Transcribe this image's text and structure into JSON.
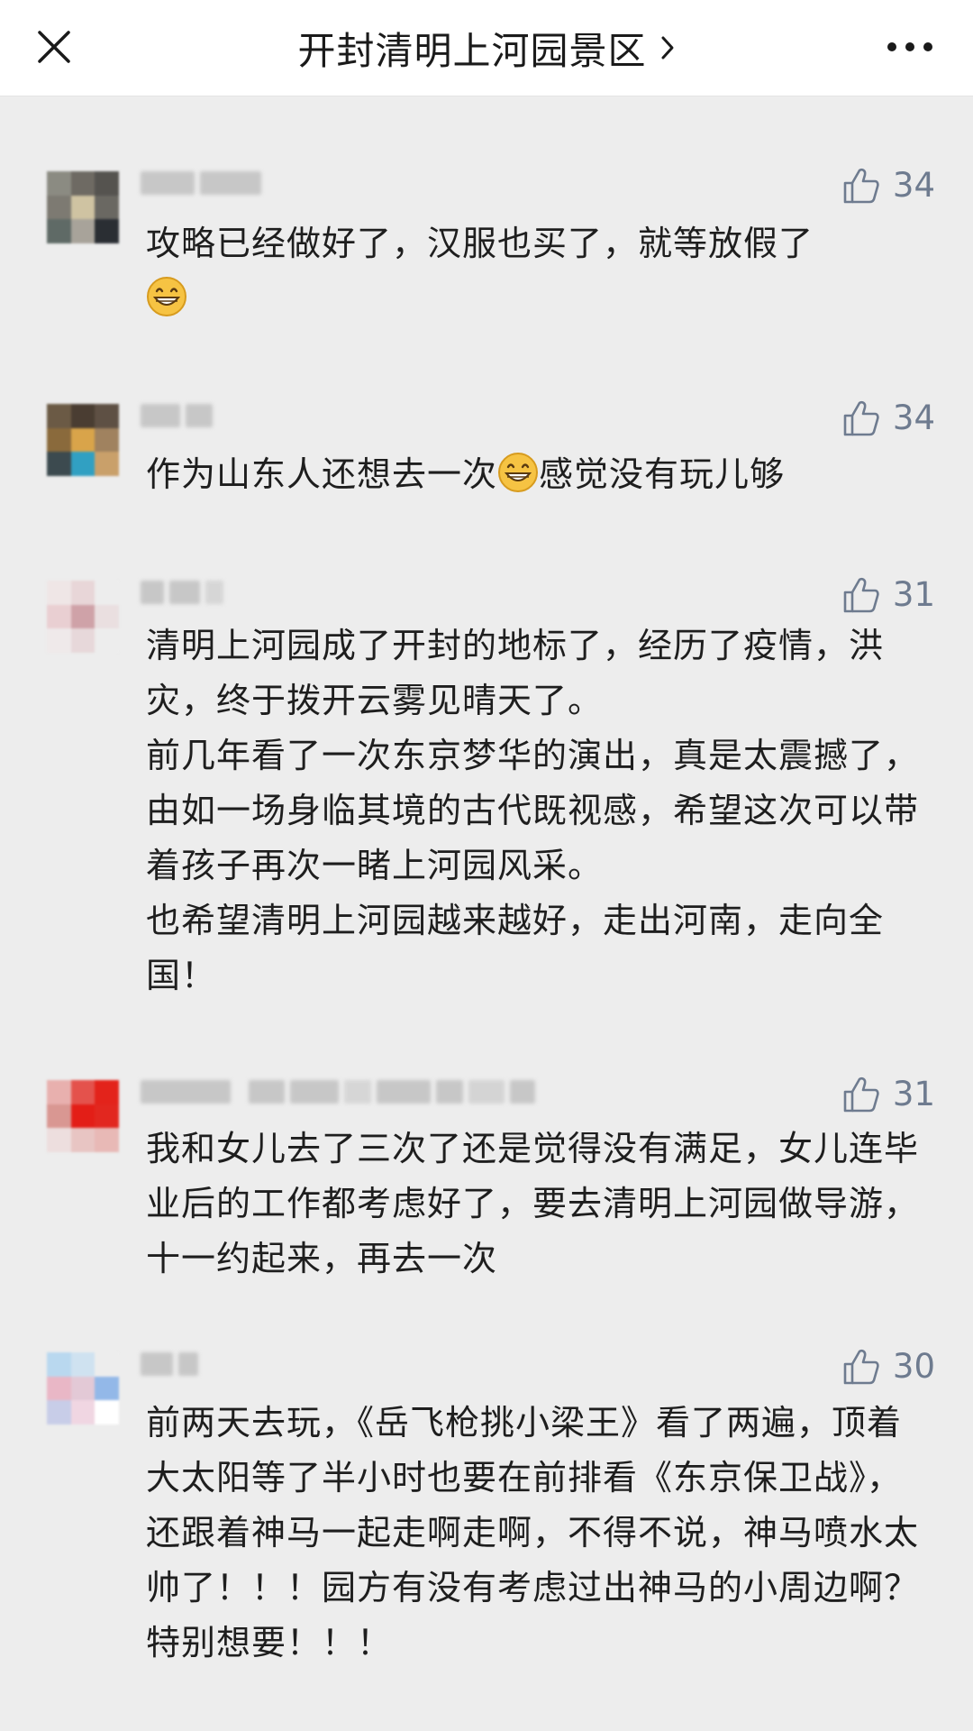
{
  "header": {
    "title": "开封清明上河园景区",
    "close_icon": "close-icon",
    "chevron_icon": "chevron-right-icon",
    "more_icon": "more-dots-icon"
  },
  "comments": [
    {
      "likes": "34",
      "text_before_emoji": "攻略已经做好了，汉服也买了，就等放假了",
      "emoji": "grinning-face-icon",
      "text_after_emoji": ""
    },
    {
      "likes": "34",
      "text_before_emoji": "作为山东人还想去一次",
      "emoji": "grinning-face-icon",
      "text_after_emoji": "感觉没有玩儿够"
    },
    {
      "likes": "31",
      "text": "清明上河园成了开封的地标了，经历了疫情，洪灾，终于拨开云雾见晴天了。\n前几年看了一次东京梦华的演出，真是太震撼了，由如一场身临其境的古代既视感，希望这次可以带着孩子再次一睹上河园风采。\n也希望清明上河园越来越好，走出河南，走向全国！"
    },
    {
      "likes": "31",
      "text": "我和女儿去了三次了还是觉得没有满足，女儿连毕业后的工作都考虑好了，要去清明上河园做导游，十一约起来，再去一次"
    },
    {
      "likes": "30",
      "text": "前两天去玩，《岳飞枪挑小梁王》看了两遍，顶着大太阳等了半小时也要在前排看《东京保卫战》，还跟着神马一起走啊走啊，不得不说，神马喷水太帅了！！！园方有没有考虑过出神马的小周边啊？特别想要！！！"
    }
  ],
  "colors": {
    "background": "#ededed",
    "header_bg": "#ffffff",
    "like_color": "#6e7b8f",
    "text": "#1e1e1e"
  }
}
